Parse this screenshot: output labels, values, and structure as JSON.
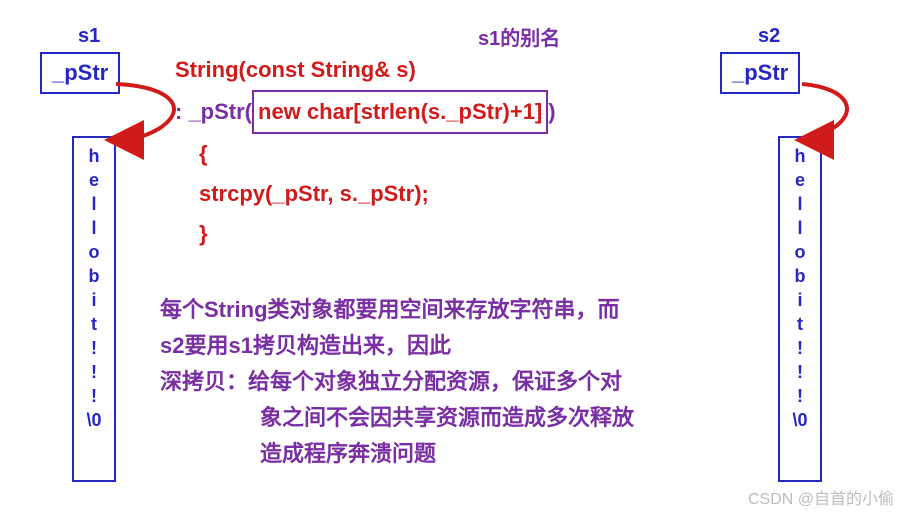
{
  "labels": {
    "s1": "s1",
    "s2": "s2",
    "ptr": "_pStr",
    "alias": "s1的别名"
  },
  "memory": {
    "chars": [
      "h",
      "e",
      "l",
      "l",
      "o",
      "",
      "b",
      "i",
      "t",
      "!",
      "!",
      "!",
      "\\0"
    ]
  },
  "code": {
    "line1_a": "String(const String& s)",
    "line2_a": ": _pStr(",
    "line2_b": "new char[strlen(s._pStr)+1]",
    "line2_c": ")",
    "line3": "{",
    "line4": "strcpy(_pStr, s._pStr);",
    "line5": "}"
  },
  "desc": {
    "l1": "每个String类对象都要用空间来存放字符串，而",
    "l2": "s2要用s1拷贝构造出来，因此",
    "l3": "深拷贝：给每个对象独立分配资源，保证多个对",
    "l4": "象之间不会因共享资源而造成多次释放",
    "l5": "造成程序奔溃问题"
  },
  "watermark": "CSDN @自首的小偷"
}
